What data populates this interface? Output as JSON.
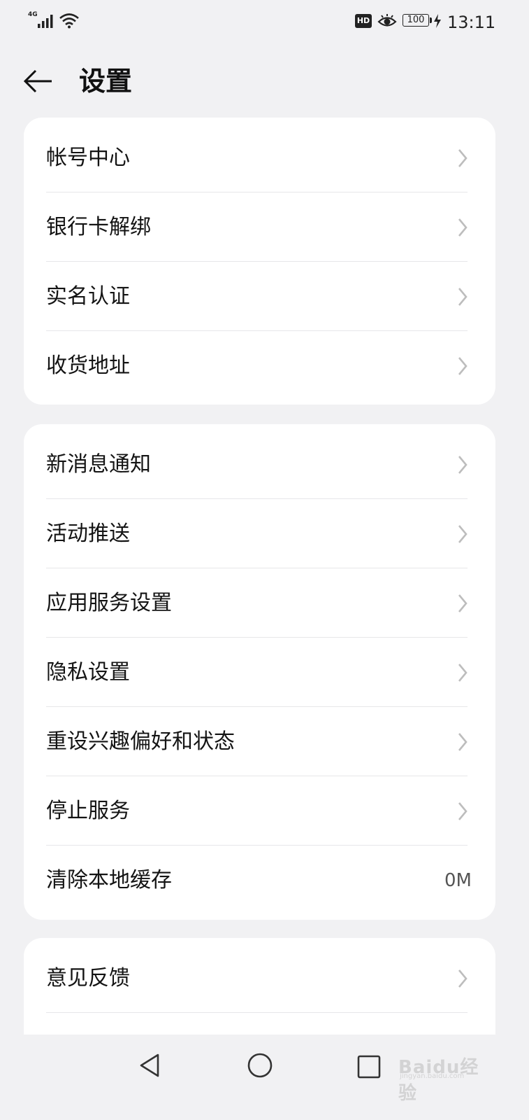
{
  "status_bar": {
    "network": "4G",
    "hd": "HD",
    "battery": "100",
    "time": "13:11",
    "icons": [
      "signal-icon",
      "wifi-icon",
      "hd-icon",
      "eye-comfort-icon",
      "battery-icon",
      "charging-icon"
    ]
  },
  "header": {
    "title": "设置",
    "back_icon": "arrow-left-icon"
  },
  "groups": [
    {
      "items": [
        {
          "label": "帐号中心",
          "icon": "chevron-right-icon"
        },
        {
          "label": "银行卡解绑",
          "icon": "chevron-right-icon"
        },
        {
          "label": "实名认证",
          "icon": "chevron-right-icon"
        },
        {
          "label": "收货地址",
          "icon": "chevron-right-icon"
        }
      ]
    },
    {
      "items": [
        {
          "label": "新消息通知",
          "icon": "chevron-right-icon"
        },
        {
          "label": "活动推送",
          "icon": "chevron-right-icon"
        },
        {
          "label": "应用服务设置",
          "icon": "chevron-right-icon"
        },
        {
          "label": "隐私设置",
          "icon": "chevron-right-icon"
        },
        {
          "label": "重设兴趣偏好和状态",
          "icon": "chevron-right-icon"
        },
        {
          "label": "停止服务",
          "icon": "chevron-right-icon"
        },
        {
          "label": "清除本地缓存",
          "value": "0M"
        }
      ]
    },
    {
      "items": [
        {
          "label": "意见反馈",
          "icon": "chevron-right-icon"
        }
      ]
    }
  ],
  "nav_bar": {
    "icons": [
      "nav-back-triangle-icon",
      "nav-home-circle-icon",
      "nav-recents-square-icon"
    ]
  },
  "watermark": {
    "text": "Baidu经验",
    "sub": "jingyan.baidu.com"
  }
}
